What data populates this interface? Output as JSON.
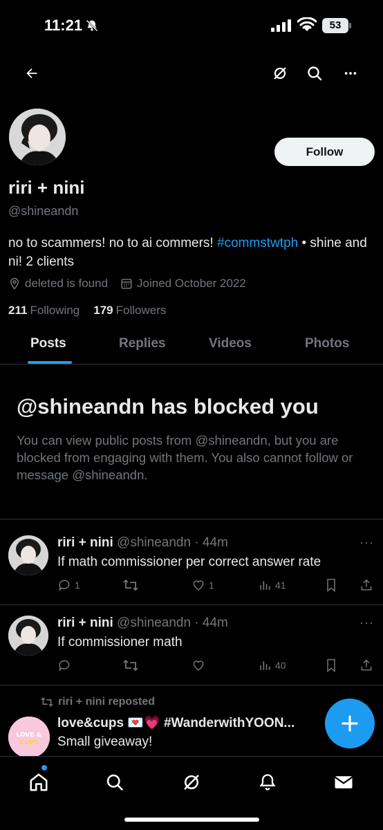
{
  "status_bar": {
    "time": "11:21",
    "battery": "53"
  },
  "nav": {
    "back_icon": "arrow-left-icon",
    "grok_icon": "grok-icon",
    "search_icon": "search-icon",
    "more_icon": "more-horizontal-icon"
  },
  "profile": {
    "follow_label": "Follow",
    "display_name": "riri + nini",
    "handle": "@shineandn",
    "bio_prefix": "no to scammers! no to ai commers! ",
    "bio_hashtag": "#commstwtph",
    "bio_suffix": " • shine and ni! 2 clients",
    "location": "deleted is found",
    "joined": "Joined October 2022",
    "following_count": "211",
    "following_label": "Following",
    "followers_count": "179",
    "followers_label": "Followers"
  },
  "tabs": [
    "Posts",
    "Replies",
    "Videos",
    "Photos"
  ],
  "blocked": {
    "title": "@shineandn has blocked you",
    "description": "You can view public posts from @shineandn, but you are blocked from engaging with them. You also cannot follow or message @shineandn."
  },
  "posts": [
    {
      "name": "riri + nini",
      "handle_time": " @shineandn · 44m",
      "text": "If math commissioner per correct answer rate",
      "replies": "1",
      "reposts": "",
      "likes": "1",
      "views": "41"
    },
    {
      "name": "riri + nini",
      "handle_time": " @shineandn · 44m",
      "text": "If commissioner math",
      "replies": "",
      "reposts": "",
      "likes": "",
      "views": "40"
    }
  ],
  "repost": {
    "label": "riri + nini reposted",
    "name": "love&cups 💌💗 #WanderwithYOON...",
    "text": "Small giveaway!",
    "avatar_text": "LOVE & CUPS"
  },
  "more_label": "···",
  "colors": {
    "accent": "#1d9bf0",
    "background": "#000000",
    "muted": "#71767b",
    "text": "#e7e9ea"
  },
  "bottom_nav": [
    "home-icon",
    "search-icon",
    "grok-icon",
    "notifications-icon",
    "messages-icon"
  ]
}
